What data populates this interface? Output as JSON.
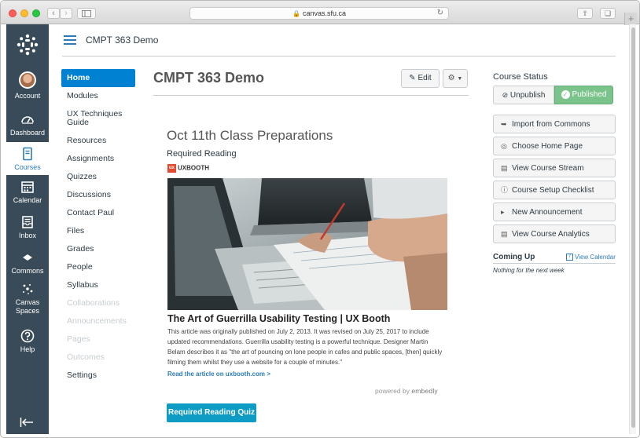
{
  "browser": {
    "url": "canvas.sfu.ca",
    "icons": [
      "back-icon",
      "forward-icon",
      "sidebar-icon",
      "lock-icon",
      "reload-icon",
      "share-icon",
      "tabs-icon",
      "new-tab-icon"
    ]
  },
  "global_nav": {
    "items": [
      {
        "label": "Account",
        "icon": "avatar"
      },
      {
        "label": "Dashboard",
        "icon": "dashboard-icon"
      },
      {
        "label": "Courses",
        "icon": "courses-icon",
        "active": true
      },
      {
        "label": "Calendar",
        "icon": "calendar-icon"
      },
      {
        "label": "Inbox",
        "icon": "inbox-icon"
      },
      {
        "label": "Commons",
        "icon": "commons-icon"
      },
      {
        "label": "Canvas\nSpaces",
        "icon": "spaces-icon"
      },
      {
        "label": "Help",
        "icon": "help-icon"
      }
    ],
    "colors": {
      "background": "#394b58",
      "active_text": "#2d7bb6"
    }
  },
  "header": {
    "breadcrumb": "CMPT 363 Demo"
  },
  "course_nav": {
    "items": [
      {
        "label": "Home",
        "state": "active"
      },
      {
        "label": "Modules",
        "state": "normal"
      },
      {
        "label": "UX Techniques Guide",
        "state": "normal"
      },
      {
        "label": "Resources",
        "state": "normal"
      },
      {
        "label": "Assignments",
        "state": "normal"
      },
      {
        "label": "Quizzes",
        "state": "normal"
      },
      {
        "label": "Discussions",
        "state": "normal"
      },
      {
        "label": "Contact Paul",
        "state": "normal"
      },
      {
        "label": "Files",
        "state": "normal"
      },
      {
        "label": "Grades",
        "state": "normal"
      },
      {
        "label": "People",
        "state": "normal"
      },
      {
        "label": "Syllabus",
        "state": "normal"
      },
      {
        "label": "Collaborations",
        "state": "disabled"
      },
      {
        "label": "Announcements",
        "state": "disabled"
      },
      {
        "label": "Pages",
        "state": "disabled"
      },
      {
        "label": "Outcomes",
        "state": "disabled"
      },
      {
        "label": "Settings",
        "state": "normal"
      }
    ],
    "colors": {
      "active_bg": "#0081d2"
    }
  },
  "main": {
    "title": "CMPT 363 Demo",
    "edit_label": "Edit",
    "content_title": "Oct 11th Class Preparations",
    "required_reading": "Required Reading",
    "provider": "UXBOOTH",
    "provider_logo_text": "ux",
    "article_title": "The Art of Guerrilla Usability Testing | UX Booth",
    "article_description": "This article was originally published on July 2, 2013. It was revised on July 25, 2017 to include updated recommendations. Guerrilla usability testing is a powerful technique. Designer Martin Belam describes it as \"the art of pouncing on lone people in cafes and public spaces, [then] quickly filming them whilst they use a website for a couple of minutes.\"",
    "article_link": "Read the article on uxbooth.com >",
    "powered_by": "powered by",
    "powered_brand": "embedly",
    "quiz_button": "Required Reading Quiz"
  },
  "sidebar": {
    "status_label": "Course Status",
    "unpublish_label": "Unpublish",
    "published_label": "Published",
    "buttons": [
      {
        "label": "Import from Commons",
        "icon": "import-icon"
      },
      {
        "label": "Choose Home Page",
        "icon": "target-icon"
      },
      {
        "label": "View Course Stream",
        "icon": "stream-icon"
      },
      {
        "label": "Course Setup Checklist",
        "icon": "question-icon"
      },
      {
        "label": "New Announcement",
        "icon": "megaphone-icon"
      },
      {
        "label": "View Course Analytics",
        "icon": "analytics-icon"
      }
    ],
    "coming_up": "Coming Up",
    "view_calendar": "View Calendar",
    "nothing_text": "Nothing for the next week",
    "colors": {
      "published": "#7ac38a"
    }
  }
}
